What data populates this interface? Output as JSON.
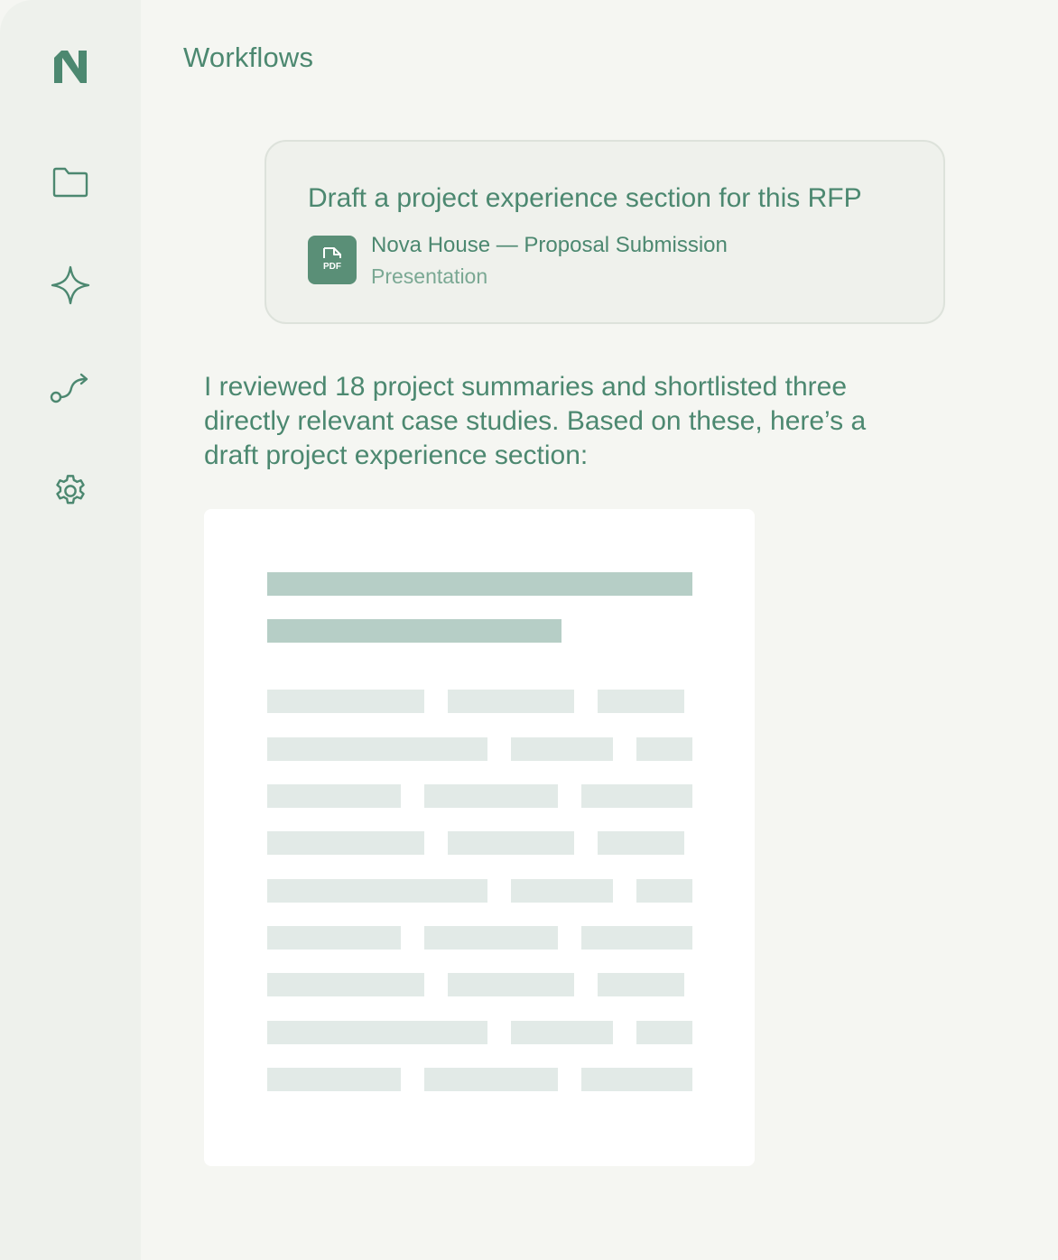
{
  "app": {
    "page_title": "Workflows"
  },
  "sidebar": {
    "items": [
      {
        "name": "logo",
        "icon": "logo-icon"
      },
      {
        "name": "files",
        "icon": "folder-icon"
      },
      {
        "name": "assistant",
        "icon": "sparkle-icon"
      },
      {
        "name": "workflows",
        "icon": "workflow-icon"
      },
      {
        "name": "settings",
        "icon": "gear-icon"
      }
    ]
  },
  "prompt": {
    "text": "Draft a project experience section for this RFP",
    "attachment": {
      "icon_label": "PDF",
      "name": "Nova House — Proposal Submission",
      "type": "Presentation"
    }
  },
  "response": {
    "text": "I reviewed 18 project summaries and shortlisted three directly relevant case studies. Based on these, here’s a draft project experience section:"
  },
  "colors": {
    "accent": "#4c8870",
    "icon_bg": "#5a8f77",
    "sidebar_bg": "#eef1ec",
    "page_bg": "#f5f6f2",
    "placeholder_heading": "#b6cec6",
    "placeholder_body": "#e2eae7"
  }
}
